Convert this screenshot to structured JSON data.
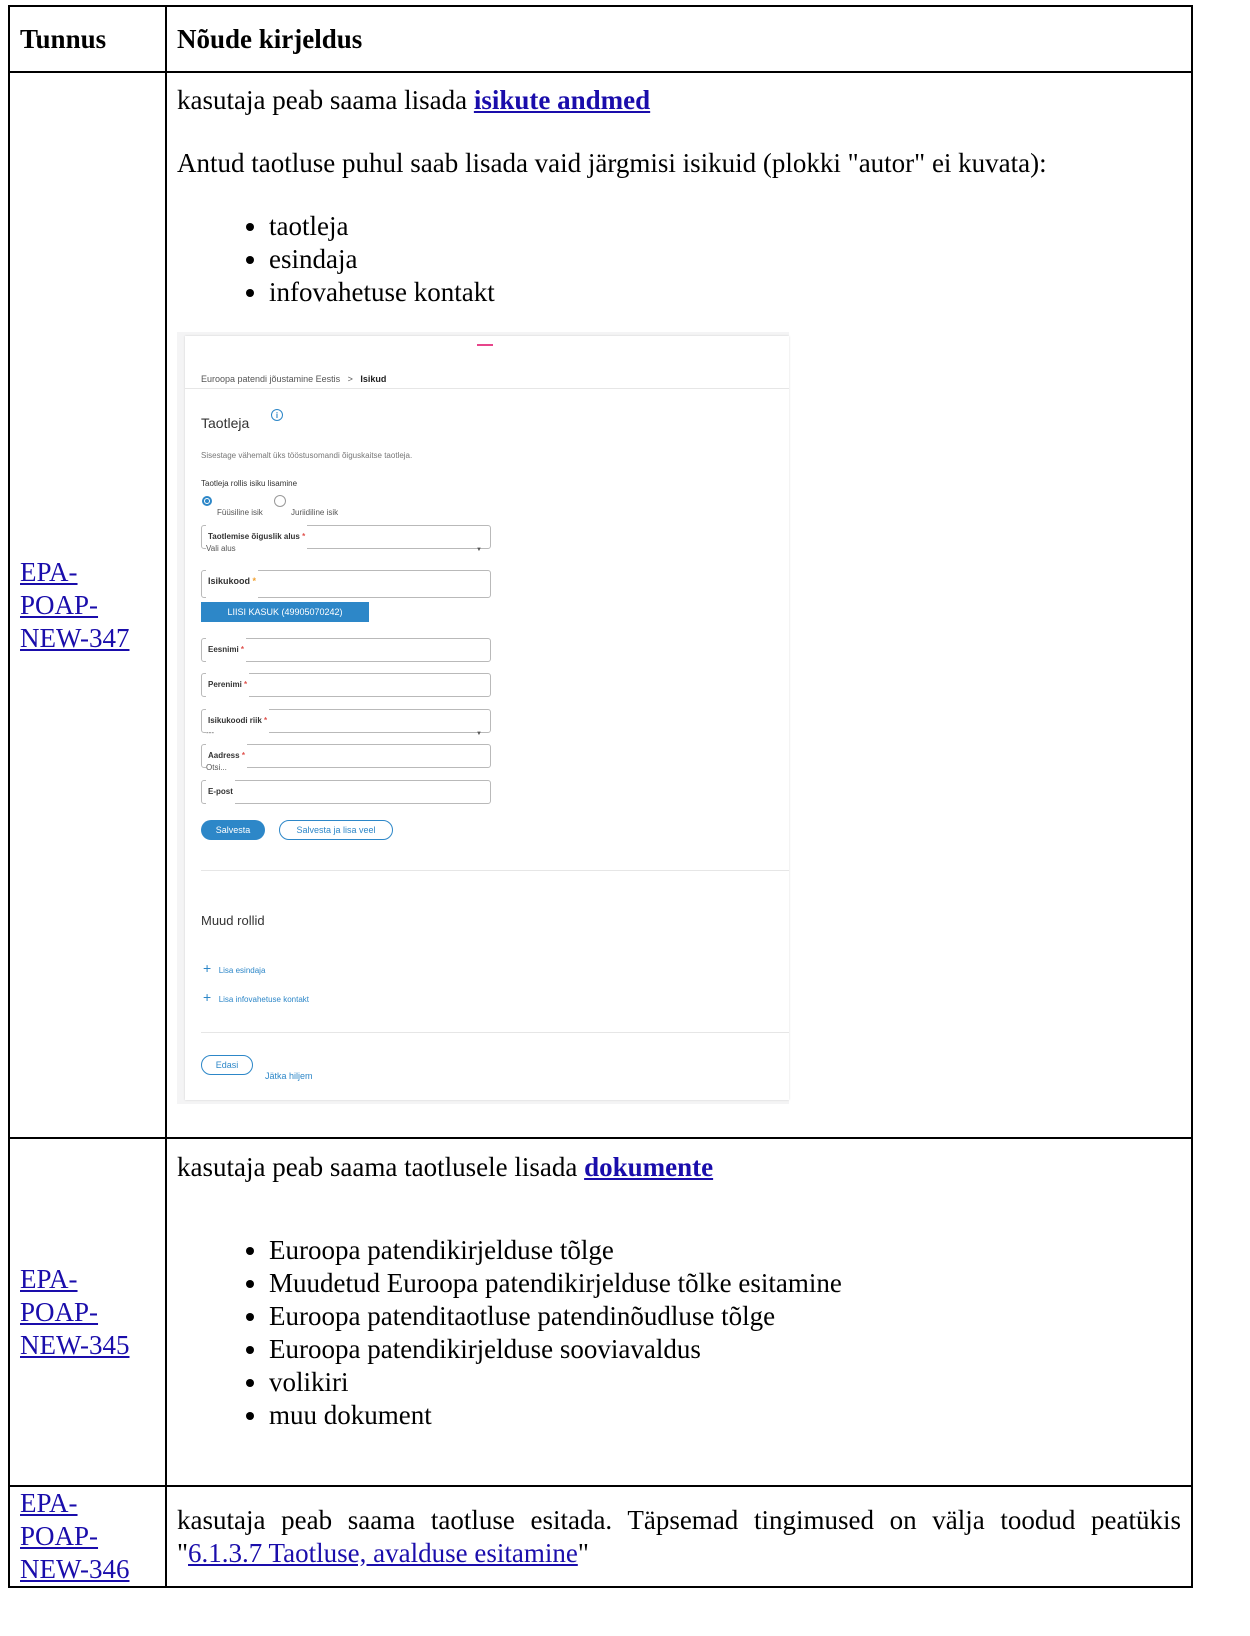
{
  "table": {
    "header": {
      "col1": "Tunnus",
      "col2": "Nõude kirjeldus"
    },
    "row1": {
      "id_line1": "EPA-POAP-",
      "id_line2": "NEW-347",
      "intro_prefix": "kasutaja peab saama lisada ",
      "intro_link": "isikute andmed",
      "note": "Antud taotluse puhul saab lisada vaid järgmisi isikuid (plokki \"autor\" ei kuvata):",
      "items": [
        "taotleja",
        "esindaja",
        "infovahetuse kontakt"
      ]
    },
    "row2": {
      "id_line1": "EPA-POAP-",
      "id_line2": "NEW-345",
      "intro_prefix": "kasutaja peab saama taotlusele lisada ",
      "intro_link": "dokumente",
      "items": [
        "Euroopa patendikirjelduse tõlge",
        "Muudetud Euroopa patendikirjelduse tõlke esitamine",
        "Euroopa patenditaotluse patendinõudluse tõlge",
        "Euroopa patendikirjelduse sooviavaldus",
        "volikiri",
        "muu dokument"
      ]
    },
    "row3": {
      "id_line1": "EPA-POAP-",
      "id_line2": "NEW-346",
      "text_prefix": "kasutaja peab saama taotluse esitada. Täpsemad tingimused on välja toodud peatükis \"",
      "text_link": "6.1.3.7 Taotluse, avalduse esitamine",
      "text_suffix": "\""
    }
  },
  "screenshot": {
    "breadcrumb_parent": "Euroopa patendi jõustamine Eestis",
    "breadcrumb_sep": ">",
    "breadcrumb_current": "Isikud",
    "section_title": "Taotleja",
    "info_icon": "i",
    "helper_text": "Sisestage vähemalt üks tööstusomandi õiguskaitse taotleja.",
    "subsection_label": "Taotleja rollis isiku lisamine",
    "radio_natural": "Füüsiline isik",
    "radio_legal": "Juriidiline isik",
    "fields": {
      "legal_basis_label": "Taotlemise õiguslik alus",
      "legal_basis_value": "Vali alus",
      "id_code_label": "Isikukood",
      "suggestion": "LIISI KASUK (49905070242)",
      "first_name_label": "Eesnimi",
      "last_name_label": "Perenimi",
      "country_label": "Isikukoodi riik",
      "country_value": "---",
      "address_label": "Aadress",
      "address_placeholder": "Otsi...",
      "email_label": "E-post",
      "required_mark": "*"
    },
    "save_button": "Salvesta",
    "save_add_button": "Salvesta ja lisa veel",
    "other_roles_title": "Muud rollid",
    "add_representative": "Lisa esindaja",
    "add_contact": "Lisa infovahetuse kontakt",
    "next_button": "Edasi",
    "continue_later": "Jätka hiljem"
  }
}
